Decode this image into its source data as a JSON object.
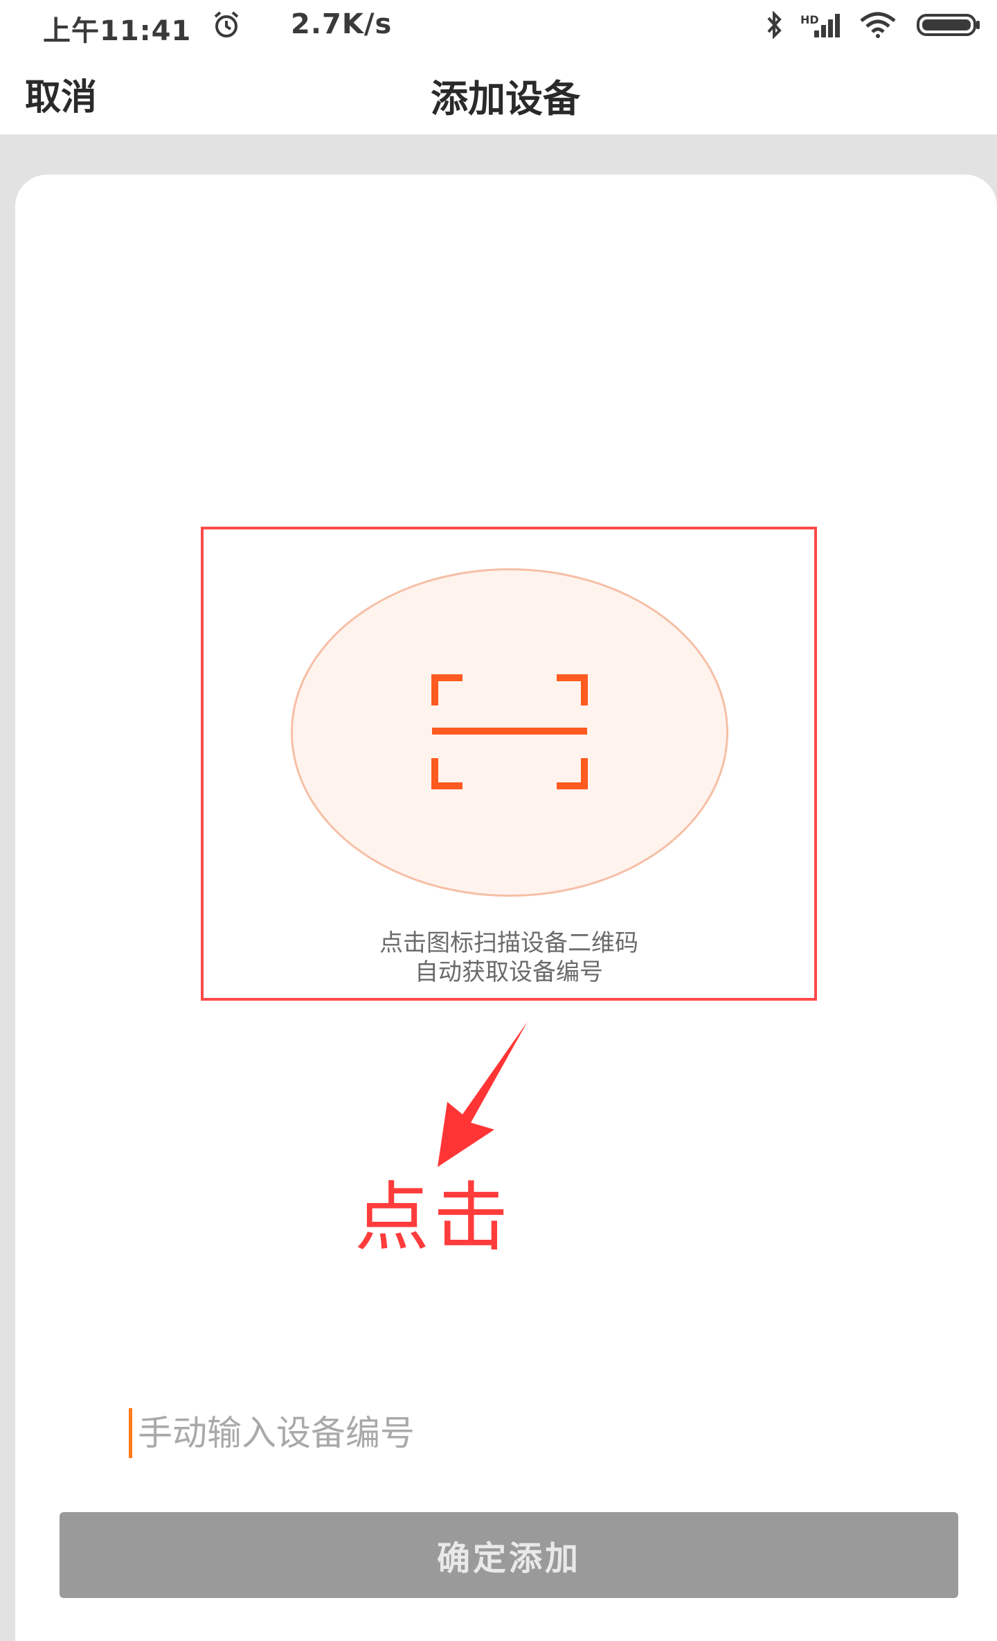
{
  "status_bar": {
    "time": "上午11:41",
    "network_speed": "2.7K/s",
    "icons": [
      "alarm-icon",
      "bluetooth-icon",
      "signal-icon",
      "wifi-icon",
      "battery-icon"
    ]
  },
  "nav": {
    "cancel_label": "取消",
    "title": "添加设备"
  },
  "scan": {
    "icon": "scan-frame-icon",
    "hint_line1": "点击图标扫描设备二维码",
    "hint_line2": "自动获取设备编号"
  },
  "annotation": {
    "click_label": "点击"
  },
  "manual_input": {
    "value": "",
    "placeholder": "手动输入设备编号"
  },
  "confirm_button": {
    "label": "确定添加"
  },
  "colors": {
    "accent": "#ff5a1f",
    "annotation_red": "#ff3c3c",
    "button_gray": "#9a9a9a",
    "circle_fill": "#fff3ee"
  }
}
